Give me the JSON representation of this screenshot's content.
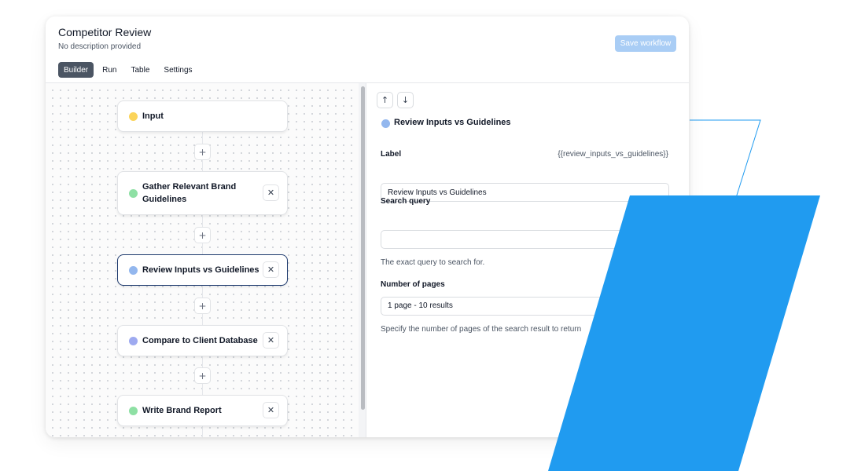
{
  "window": {
    "title": "Competitor Review",
    "subtitle": "No description provided",
    "save_label": "Save workflow"
  },
  "tabs": [
    {
      "label": "Builder",
      "active": true
    },
    {
      "label": "Run",
      "active": false
    },
    {
      "label": "Table",
      "active": false
    },
    {
      "label": "Settings",
      "active": false
    }
  ],
  "nodes": [
    {
      "label": "Input",
      "color": "#fbd45a",
      "selected": false,
      "closable": false
    },
    {
      "label": "Gather Relevant Brand Guidelines",
      "color": "#8ee0a4",
      "selected": false,
      "closable": true
    },
    {
      "label": "Review Inputs vs Guidelines",
      "color": "#93b7ee",
      "selected": true,
      "closable": true
    },
    {
      "label": "Compare to Client Database",
      "color": "#9eaaf0",
      "selected": false,
      "closable": true
    },
    {
      "label": "Write Brand Report",
      "color": "#8ee0a4",
      "selected": false,
      "closable": true
    }
  ],
  "icons": {
    "plus": "+",
    "close": "✕",
    "arrow_up": "↑",
    "arrow_down": "↓"
  },
  "panel": {
    "title": "Review Inputs vs Guidelines",
    "label_field": {
      "label": "Label",
      "template_var": "{{review_inputs_vs_guidelines}}",
      "value": "Review Inputs vs Guidelines"
    },
    "search_field": {
      "label": "Search query",
      "value": "",
      "help": "The exact query to search for."
    },
    "pages_field": {
      "label": "Number of pages",
      "value": "1 page - 10 results",
      "help": "Specify the number of pages of the search result to return"
    }
  },
  "colors": {
    "accent_blue": "#209bf0",
    "save_button": "#a9cdf5",
    "selected_border": "#1e3a6e"
  }
}
